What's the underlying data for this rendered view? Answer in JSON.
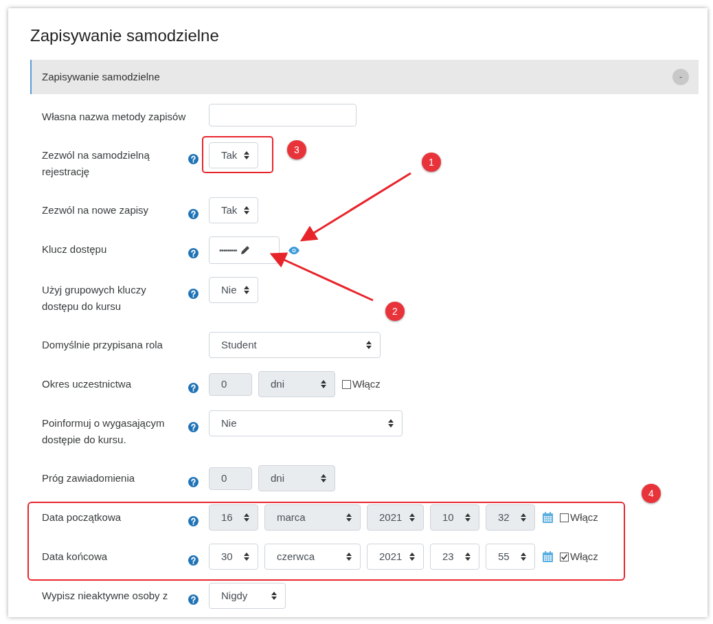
{
  "page_title": "Zapisywanie samodzielne",
  "section": {
    "title": "Zapisywanie samodzielne",
    "expanded": true,
    "toggle_label": "-"
  },
  "rows": [
    {
      "label": "Własna nazwa metody zapisów",
      "help": false,
      "controls": [
        {
          "kind": "text",
          "disabled": false
        }
      ]
    },
    {
      "label": "Zezwól na samodzielną rejestrację",
      "help": true,
      "controls": [
        {
          "kind": "select",
          "value": "Tak",
          "disabled": false
        }
      ]
    },
    {
      "label": "Zezwól na nowe zapisy",
      "help": true,
      "controls": [
        {
          "kind": "select",
          "value": "Tak",
          "disabled": false
        }
      ]
    },
    {
      "label": "Klucz dostępu",
      "help": true,
      "controls": [
        {
          "kind": "password",
          "value": "•••••••••"
        },
        {
          "kind": "reveal"
        }
      ]
    },
    {
      "label": "Użyj grupowych kluczy dostępu do kursu",
      "help": true,
      "controls": [
        {
          "kind": "select",
          "value": "Nie",
          "disabled": false
        }
      ]
    },
    {
      "label": "Domyślnie przypisana rola",
      "help": false,
      "controls": [
        {
          "kind": "select",
          "value": "Student",
          "disabled": false
        }
      ]
    },
    {
      "label": "Okres uczestnictwa",
      "help": true,
      "controls": [
        {
          "kind": "text",
          "value": "0",
          "disabled": true
        },
        {
          "kind": "select",
          "value": "dni",
          "disabled": true
        },
        {
          "kind": "checkbox",
          "label": "Włącz",
          "checked": false
        }
      ]
    },
    {
      "label": "Poinformuj o wygasającym dostępie do kursu.",
      "help": true,
      "controls": [
        {
          "kind": "select",
          "value": "Nie",
          "disabled": false
        }
      ]
    },
    {
      "label": "Próg zawiadomienia",
      "help": true,
      "controls": [
        {
          "kind": "text",
          "value": "0",
          "disabled": true
        },
        {
          "kind": "select",
          "value": "dni",
          "disabled": true
        }
      ]
    },
    {
      "label": "Data początkowa",
      "help": true,
      "controls": [
        {
          "kind": "select",
          "value": "16",
          "disabled": true
        },
        {
          "kind": "select",
          "value": "marca",
          "disabled": true
        },
        {
          "kind": "select",
          "value": "2021",
          "disabled": true
        },
        {
          "kind": "select",
          "value": "10",
          "disabled": true
        },
        {
          "kind": "select",
          "value": "32",
          "disabled": true
        },
        {
          "kind": "calendar"
        },
        {
          "kind": "checkbox",
          "label": "Włącz",
          "checked": false
        }
      ]
    },
    {
      "label": "Data końcowa",
      "help": true,
      "controls": [
        {
          "kind": "select",
          "value": "30",
          "disabled": false
        },
        {
          "kind": "select",
          "value": "czerwca",
          "disabled": false
        },
        {
          "kind": "select",
          "value": "2021",
          "disabled": false
        },
        {
          "kind": "select",
          "value": "23",
          "disabled": false
        },
        {
          "kind": "select",
          "value": "55",
          "disabled": false
        },
        {
          "kind": "calendar"
        },
        {
          "kind": "checkbox",
          "label": "Włącz",
          "checked": true
        }
      ]
    },
    {
      "label": "Wypisz nieaktywne osoby z",
      "help": true,
      "controls": [
        {
          "kind": "select",
          "value": "Nigdy",
          "disabled": false
        }
      ]
    }
  ],
  "annotations": [
    {
      "label": "1"
    },
    {
      "label": "2"
    },
    {
      "label": "3"
    },
    {
      "label": "4"
    }
  ]
}
